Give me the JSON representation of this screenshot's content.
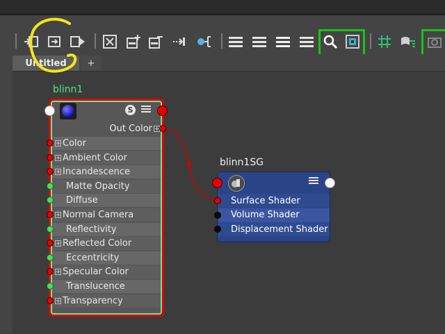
{
  "tabs": {
    "active_label": "Untitled",
    "add_label": "+"
  },
  "toolbar": {
    "icons": [
      "input-connections-icon",
      "graph-layout-icon",
      "output-connections-icon",
      "frame-selection-icon",
      "add-selected-icon",
      "remove-selected-icon",
      "pin-icon",
      "clear-graph-icon",
      "simple-mode-icon",
      "connected-mode-icon",
      "full-mode-icon",
      "custom-mode-icon",
      "search-icon",
      "grid-snap-icon",
      "grid-icon",
      "attribute-filter-icon"
    ]
  },
  "annotation": {
    "color": "#f5e51b"
  },
  "blinn": {
    "title": "blinn1",
    "out_label": "Out Color",
    "swatch_color": "#1a1adc",
    "rows": [
      {
        "label": "Color",
        "expand": true,
        "port": "red"
      },
      {
        "label": "Ambient Color",
        "expand": true,
        "port": "red"
      },
      {
        "label": "Incandescence",
        "expand": true,
        "port": "red"
      },
      {
        "label": "Matte Opacity",
        "expand": false,
        "port": "green"
      },
      {
        "label": "Diffuse",
        "expand": false,
        "port": "green"
      },
      {
        "label": "Normal Camera",
        "expand": true,
        "port": "red"
      },
      {
        "label": "Reflectivity",
        "expand": false,
        "port": "green"
      },
      {
        "label": "Reflected Color",
        "expand": true,
        "port": "red"
      },
      {
        "label": "Eccentricity",
        "expand": false,
        "port": "green"
      },
      {
        "label": "Specular Color",
        "expand": true,
        "port": "red"
      },
      {
        "label": "Translucence",
        "expand": false,
        "port": "green"
      },
      {
        "label": "Transparency",
        "expand": true,
        "port": "red"
      }
    ]
  },
  "shading_group": {
    "title": "blinn1SG",
    "rows": [
      {
        "label": "Surface Shader",
        "port": "red"
      },
      {
        "label": "Volume Shader",
        "port": "black"
      },
      {
        "label": "Displacement Shader",
        "port": "black"
      }
    ]
  },
  "colors": {
    "port_red": "#e80000",
    "port_green": "#40e060",
    "selection_green": "#6fe29a",
    "bracket_green": "#17c417",
    "sg_blue": "#2b4487",
    "connection_red": "#d00000"
  }
}
